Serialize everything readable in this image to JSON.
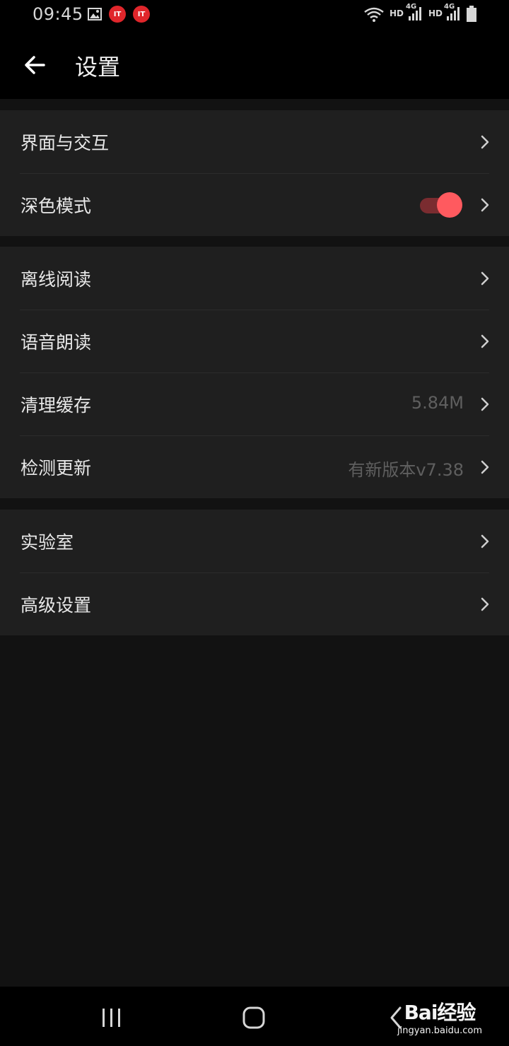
{
  "status_bar": {
    "time": "09:45",
    "icons": [
      "image-icon",
      "it-badge",
      "it-badge",
      "wifi-icon",
      "signal-icon",
      "signal-icon",
      "battery-icon"
    ],
    "badge_text": "IT",
    "hd_label": "HD",
    "net_label": "4G"
  },
  "header": {
    "title": "设置",
    "back_icon": "arrow-left-icon"
  },
  "groups": [
    {
      "rows": [
        {
          "label": "界面与交互"
        },
        {
          "label": "深色模式",
          "toggle": true
        }
      ]
    },
    {
      "rows": [
        {
          "label": "离线阅读"
        },
        {
          "label": "语音朗读"
        },
        {
          "label": "清理缓存",
          "value": "5.84M"
        },
        {
          "label": "检测更新",
          "value": "有新版本v7.38"
        }
      ]
    },
    {
      "rows": [
        {
          "label": "实验室"
        },
        {
          "label": "高级设置"
        }
      ]
    }
  ],
  "colors": {
    "accent": "#ff5a5f",
    "background": "#121212",
    "card": "#1f1f1f"
  },
  "watermark": {
    "logo": "Bai经验",
    "url": "jingyan.baidu.com"
  }
}
